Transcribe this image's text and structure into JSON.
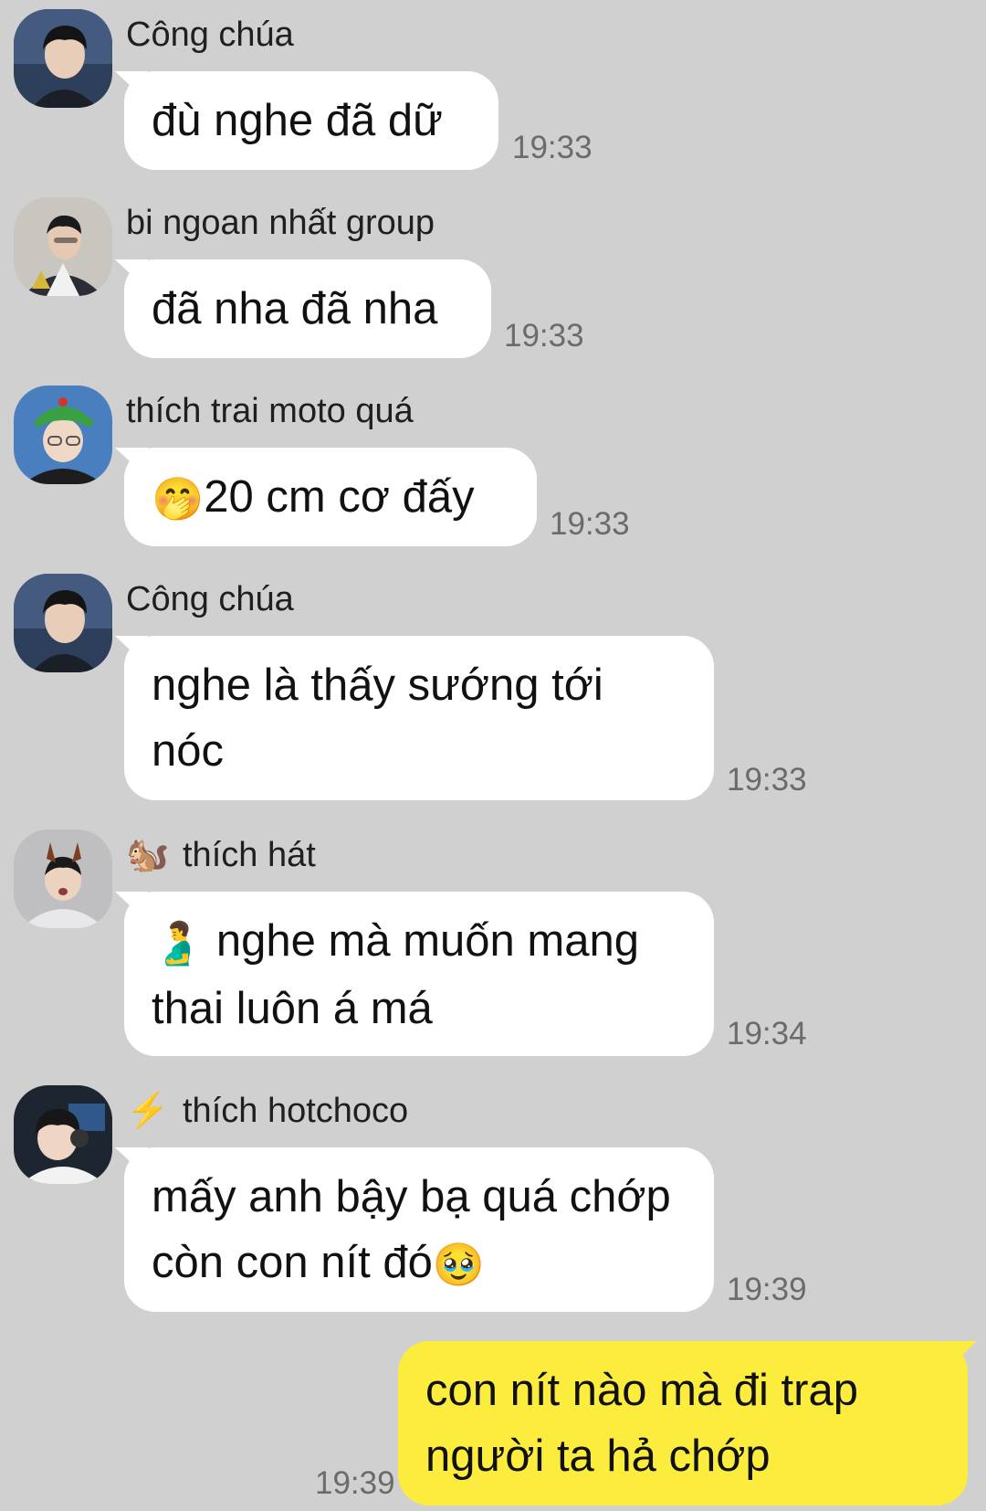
{
  "messages": [
    {
      "sender": "Công chúa",
      "sender_badge": "",
      "text": "đù nghe đã dữ",
      "text_emoji_before": "",
      "text_emoji_after": "",
      "time": "19:33"
    },
    {
      "sender": "bi ngoan nhất group",
      "sender_badge": "",
      "text": "đã nha đã nha",
      "text_emoji_before": "",
      "text_emoji_after": "",
      "time": "19:33"
    },
    {
      "sender": "thích trai moto quá",
      "sender_badge": "",
      "text": "20 cm cơ đấy",
      "text_emoji_before": "🤭",
      "text_emoji_after": "",
      "time": "19:33"
    },
    {
      "sender": "Công chúa",
      "sender_badge": "",
      "text": "nghe là thấy sướng tới nóc",
      "text_emoji_before": "",
      "text_emoji_after": "",
      "time": "19:33"
    },
    {
      "sender": "thích hát",
      "sender_badge": "🐿️",
      "text": " nghe mà muốn mang thai luôn á má",
      "text_emoji_before": "🫃",
      "text_emoji_after": "",
      "time": "19:34"
    },
    {
      "sender": "thích hotchoco",
      "sender_badge": "⚡",
      "text": "mấy anh bậy bạ  quá chớp còn con nít đó",
      "text_emoji_before": "",
      "text_emoji_after": "🥹",
      "time": "19:39"
    }
  ],
  "outgoing": {
    "text": "con nít nào mà đi trap người ta hả chớp",
    "time": "19:39"
  },
  "colors": {
    "background": "#d0d0d1",
    "incoming_bubble": "#ffffff",
    "outgoing_bubble": "#fcec3e",
    "timestamp": "#6b6b6b"
  }
}
